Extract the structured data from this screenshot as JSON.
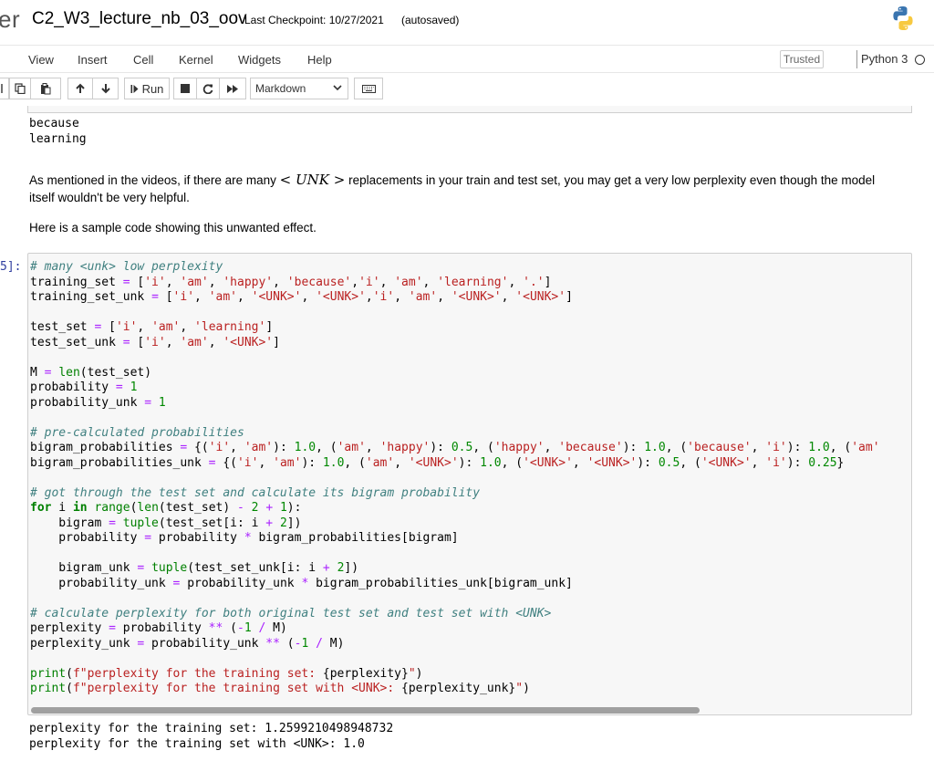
{
  "header": {
    "brand_fragment": "er",
    "notebook_name": "C2_W3_lecture_nb_03_oov",
    "checkpoint": "Last Checkpoint: 10/27/2021",
    "autosaved": "(autosaved)",
    "logo_icon": "python-logo-icon"
  },
  "menubar": {
    "items": [
      "View",
      "Insert",
      "Cell",
      "Kernel",
      "Widgets",
      "Help"
    ],
    "trusted": "Trusted",
    "kernel": "Python 3"
  },
  "toolbar": {
    "run_label": "Run",
    "cell_type": "Markdown",
    "icons": [
      "copy-icon",
      "paste-icon",
      "move-up-icon",
      "move-down-icon",
      "run-icon",
      "interrupt-icon",
      "restart-icon",
      "restart-run-all-icon",
      "keyboard-icon"
    ]
  },
  "notebook": {
    "prev_output": [
      "because",
      "learning"
    ],
    "markdown1": {
      "before": "As mentioned in the videos, if there are many ",
      "math_lt": "<",
      "math_unk": "UNK",
      "math_gt": ">",
      "after": " replacements in your train and test set, you may get a very low perplexity even though the model",
      "line2": "itself wouldn't be very helpful."
    },
    "markdown2": "Here is a sample code showing this unwanted effect.",
    "prompt": "5]:",
    "output": [
      "perplexity for the training set: 1.2599210498948732",
      "perplexity for the training set with <UNK>: 1.0"
    ]
  }
}
